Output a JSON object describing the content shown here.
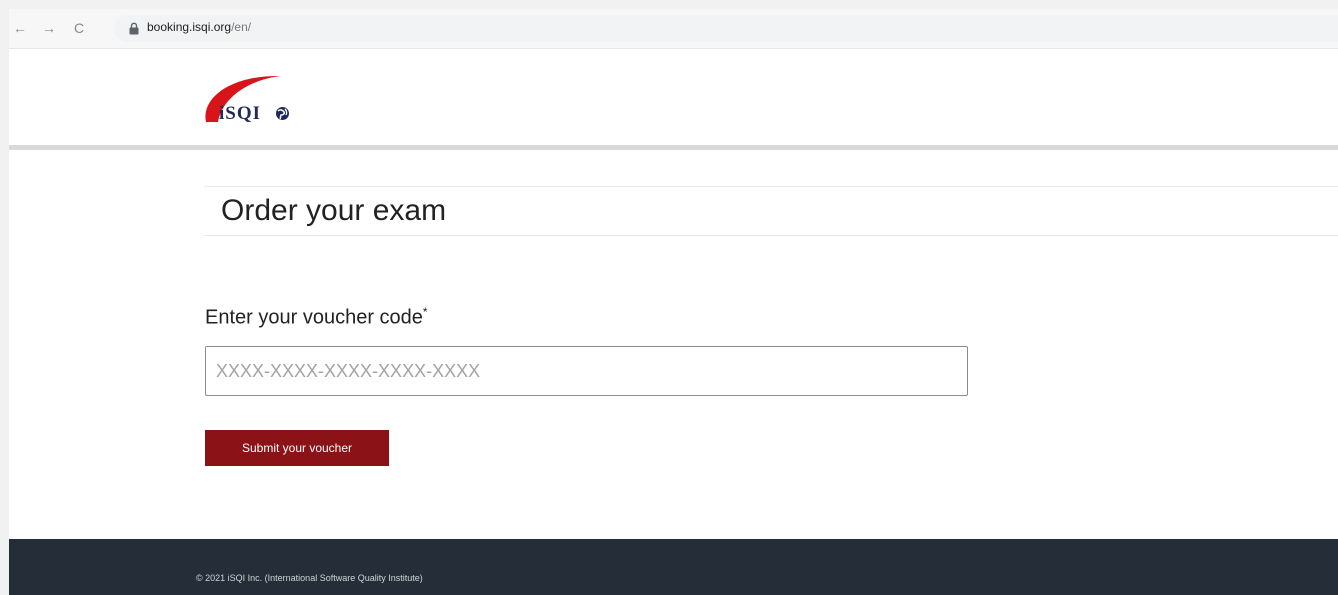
{
  "browser": {
    "url_host": "booking.isqi.org",
    "url_path": "/en/",
    "back_glyph": "←",
    "forward_glyph": "→",
    "reload_glyph": "C"
  },
  "header": {
    "logo_text": "iSQI"
  },
  "main": {
    "title": "Order your exam",
    "voucher_label": "Enter your voucher code",
    "required_mark": "*",
    "voucher_placeholder": "XXXX-XXXX-XXXX-XXXX-XXXX",
    "voucher_value": "",
    "submit_label": "Submit your voucher"
  },
  "footer": {
    "copyright": "© 2021 iSQI Inc. (International Software Quality Institute)"
  },
  "colors": {
    "brand_red": "#8b1216",
    "logo_arc": "#d7141a",
    "logo_text": "#1f2a5a",
    "footer_bg": "#252d38"
  },
  "icons": [
    "back-arrow-icon",
    "forward-arrow-icon",
    "reload-icon",
    "lock-icon",
    "globe-icon"
  ]
}
